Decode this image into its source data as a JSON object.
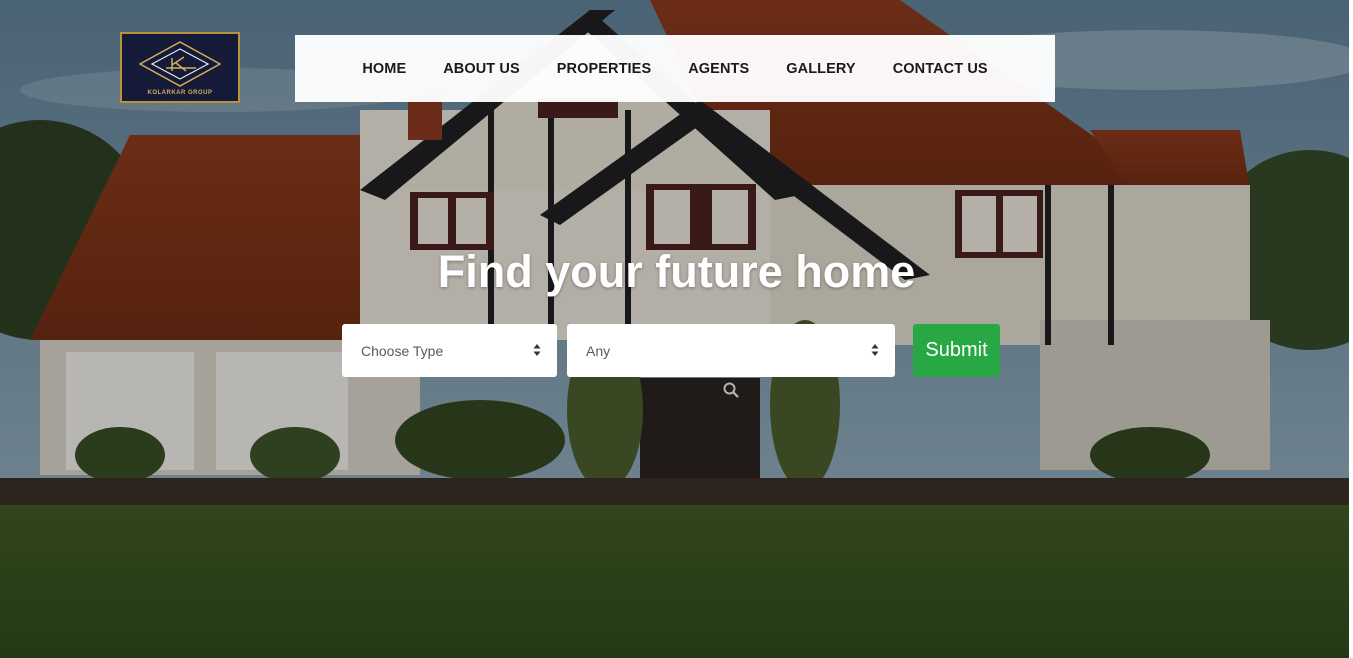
{
  "brand": {
    "logo_text": "KOLARKAR GROUP",
    "logo_colors": {
      "background": "#141a38",
      "accent": "#b8923a"
    }
  },
  "nav": {
    "items": [
      {
        "label": "HOME"
      },
      {
        "label": "ABOUT US"
      },
      {
        "label": "PROPERTIES"
      },
      {
        "label": "AGENTS"
      },
      {
        "label": "GALLERY"
      },
      {
        "label": "CONTACT US"
      }
    ]
  },
  "hero": {
    "headline": "Find your future home",
    "background_icon": "house-photo"
  },
  "search": {
    "type_select": {
      "value": "Choose Type"
    },
    "location_select": {
      "value": "Any"
    },
    "submit_label": "Submit",
    "submit_color": "#28a745"
  }
}
